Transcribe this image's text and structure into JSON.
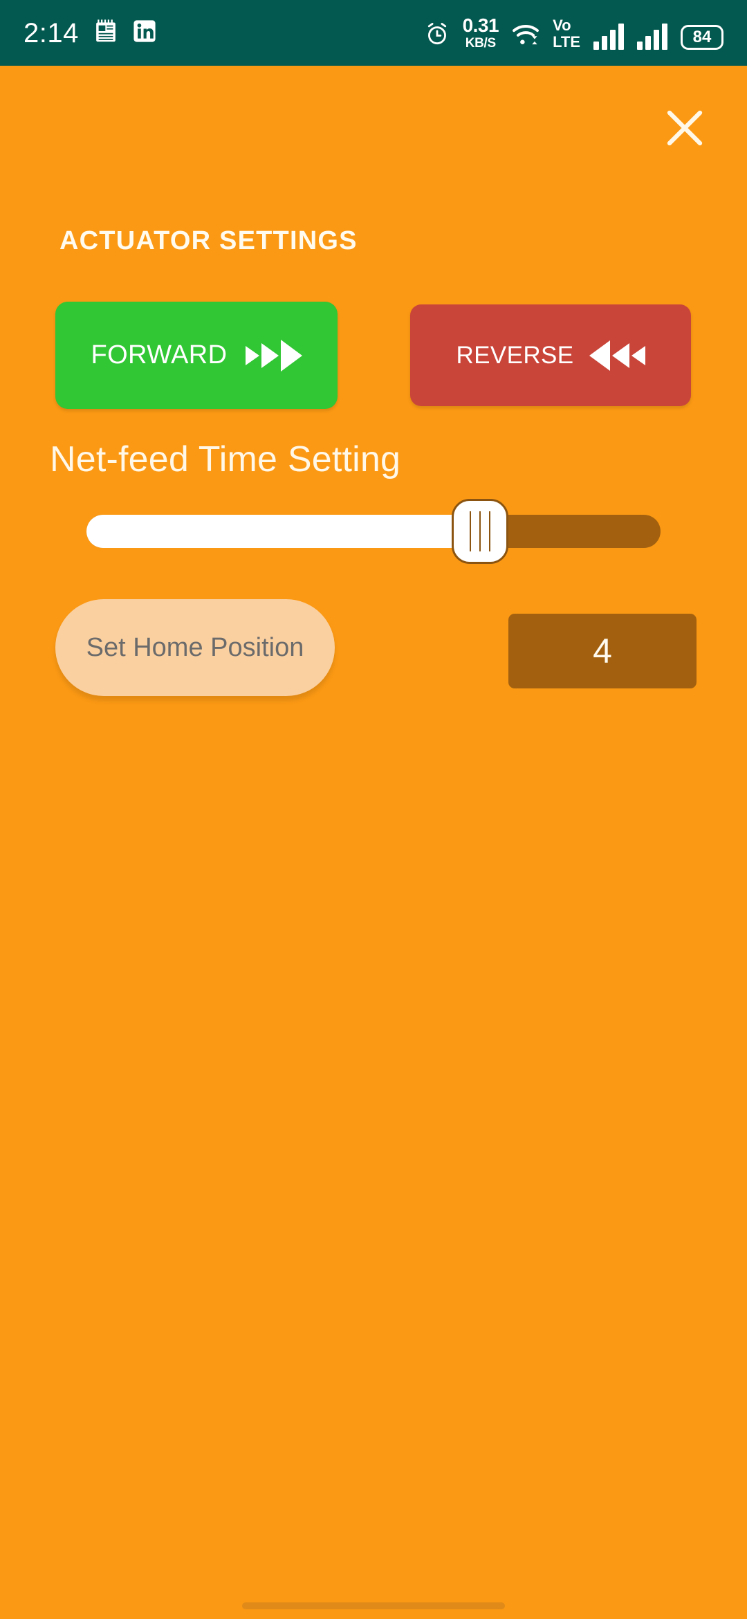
{
  "status_bar": {
    "background_color": "#03584F",
    "clock": "2:14",
    "left_icons": [
      "notes-app-icon",
      "linkedin-icon"
    ],
    "network_speed_value": "0.31",
    "network_speed_unit": "KB/S",
    "alarm_icon": "alarm-clock-icon",
    "wifi_icon": "wifi-icon",
    "volte_line1": "Vo",
    "volte_line2": "LTE",
    "signal_icons": [
      "signal-bars-sim1-icon",
      "signal-bars-sim2-icon"
    ],
    "battery_level": "84"
  },
  "screen": {
    "background_color": "#FB9914",
    "close_label": "close-icon"
  },
  "main": {
    "section_title": "ACTUATOR SETTINGS",
    "forward_button": {
      "label": "FORWARD",
      "color": "#31C634",
      "icon": "triple-right-arrow-icon"
    },
    "reverse_button": {
      "label": "REVERSE",
      "color": "#C9453A",
      "icon": "triple-left-arrow-icon"
    },
    "slider": {
      "label": "Net-feed Time Setting",
      "fill_percent": 68.5,
      "fill_color": "#FFFFFF",
      "track_color": "#A3610F",
      "thumb_color": "#FFFFFF"
    },
    "home_button": {
      "label": "Set Home Position",
      "color": "#FBD0A0",
      "text_color": "#6B6B6B"
    },
    "value_box": {
      "value": "4",
      "color": "#A3610F"
    }
  }
}
